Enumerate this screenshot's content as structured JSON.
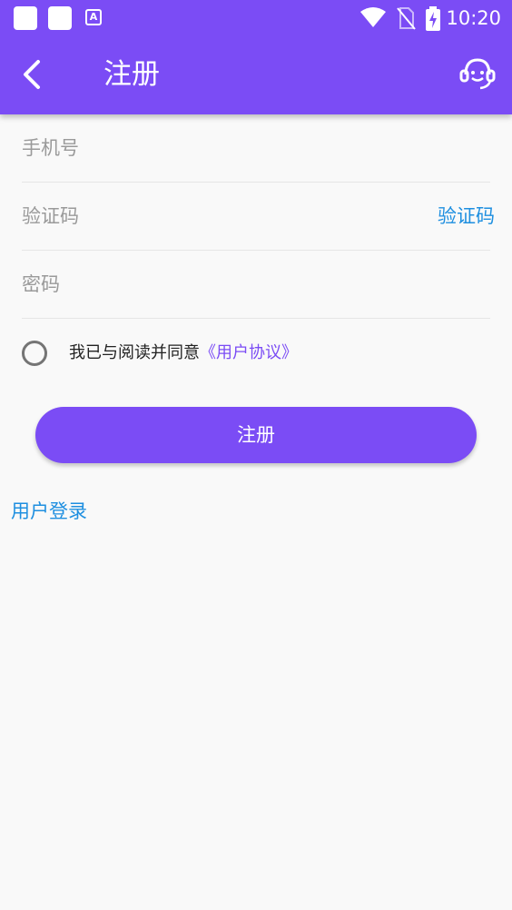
{
  "status_bar": {
    "time": "10:20",
    "app_icon_letter": "A",
    "icons": [
      "notification-square-icon",
      "notification-square-icon",
      "app-a-icon",
      "wifi-icon",
      "no-sim-icon",
      "battery-charging-icon"
    ]
  },
  "header": {
    "title": "注册",
    "back_icon": "chevron-left-icon",
    "support_icon": "customer-service-icon"
  },
  "form": {
    "phone_placeholder": "手机号",
    "code_placeholder": "验证码",
    "code_button": "验证码",
    "password_placeholder": "密码",
    "agree_text": "我已与阅读并同意",
    "agree_link": "《用户协议》",
    "agree_checked": false,
    "submit_label": "注册"
  },
  "footer": {
    "login_link": "用户登录"
  },
  "colors": {
    "primary": "#7b4cf5",
    "link": "#1e8fe0",
    "placeholder": "#9a9a9a",
    "background": "#f9f9f9"
  }
}
